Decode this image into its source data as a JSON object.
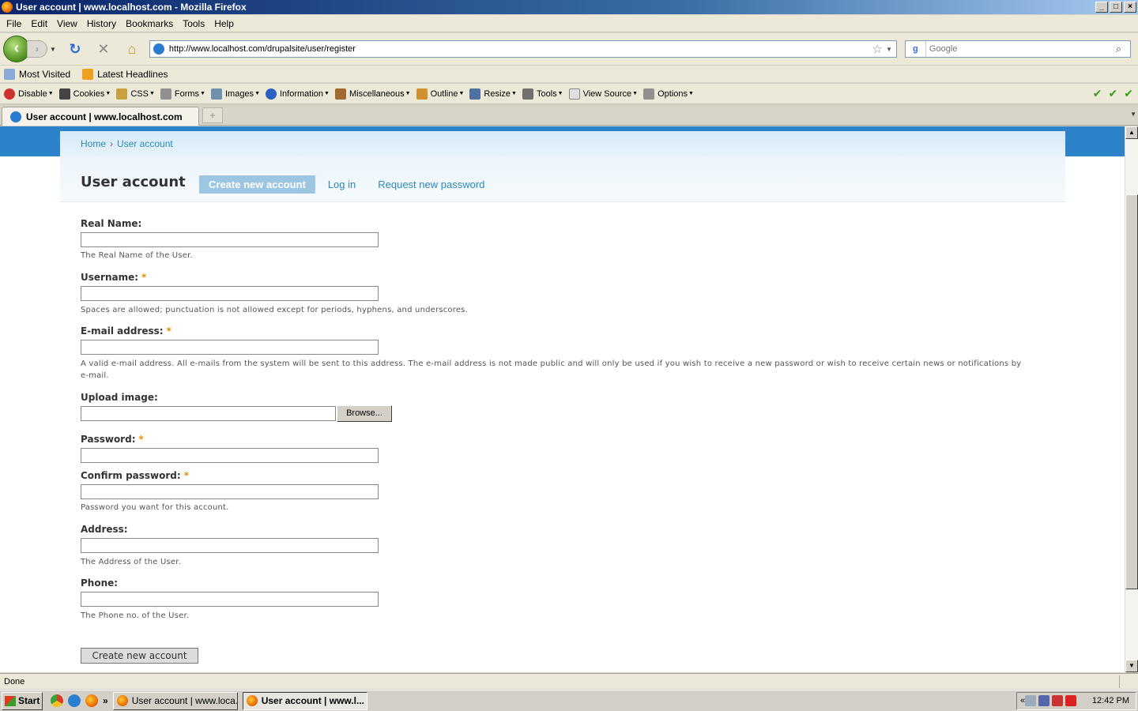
{
  "window": {
    "title": "User account | www.localhost.com - Mozilla Firefox",
    "controls": [
      "_",
      "□",
      "×"
    ]
  },
  "menubar": {
    "items": [
      "File",
      "Edit",
      "View",
      "History",
      "Bookmarks",
      "Tools",
      "Help"
    ]
  },
  "navbar": {
    "url": "http://www.localhost.com/drupalsite/user/register",
    "search_placeholder": "Google"
  },
  "bookmarks": {
    "items": [
      "Most Visited",
      "Latest Headlines"
    ]
  },
  "devbar": {
    "items": [
      "Disable",
      "Cookies",
      "CSS",
      "Forms",
      "Images",
      "Information",
      "Miscellaneous",
      "Outline",
      "Resize",
      "Tools",
      "View Source",
      "Options"
    ]
  },
  "tabbar": {
    "active_tab": "User account | www.localhost.com"
  },
  "page": {
    "breadcrumb": [
      "Home",
      "User account"
    ],
    "breadcrumb_separator": "›",
    "title": "User account",
    "tabs": [
      "Create new account",
      "Log in",
      "Request new password"
    ],
    "form": {
      "real_name": {
        "label": "Real Name:",
        "description": "The Real Name of the User."
      },
      "username": {
        "label": "Username:",
        "required_mark": "*",
        "description": "Spaces are allowed; punctuation is not allowed except for periods, hyphens, and underscores."
      },
      "email": {
        "label": "E-mail address:",
        "required_mark": "*",
        "description": "A valid e-mail address. All e-mails from the system will be sent to this address. The e-mail address is not made public and will only be used if you wish to receive a new password or wish to receive certain news or notifications by e-mail."
      },
      "upload": {
        "label": "Upload image:",
        "browse": "Browse..."
      },
      "password": {
        "label": "Password:",
        "required_mark": "*"
      },
      "confirm_password": {
        "label": "Confirm password:",
        "required_mark": "*",
        "description": "Password you want for this account."
      },
      "address": {
        "label": "Address:",
        "description": "The Address of the User."
      },
      "phone": {
        "label": "Phone:",
        "description": "The Phone no. of the User."
      },
      "submit": "Create new account"
    }
  },
  "statusbar": {
    "text": "Done"
  },
  "taskbar": {
    "start": "Start",
    "tasks": [
      "User account | www.loca...",
      "User account | www.l..."
    ],
    "clock": "12:42 PM",
    "chevrons": "«",
    "ql_chevron": "»"
  },
  "colors": {
    "link": "#2a8ab8",
    "active_tab_bg": "#9dc6e3",
    "required": "#e09000",
    "header_blue": "#2d83c9"
  }
}
